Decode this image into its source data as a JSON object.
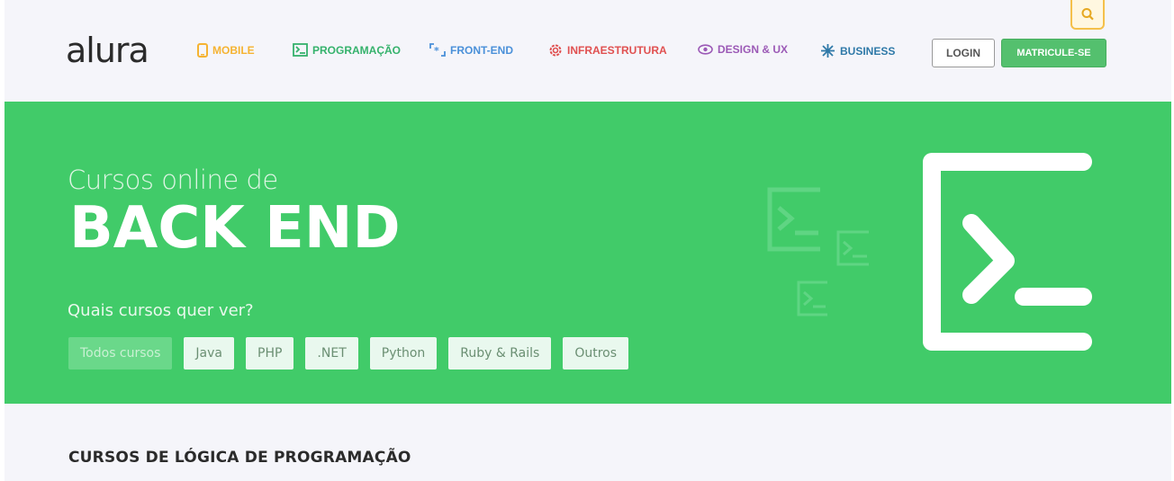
{
  "header": {
    "logo": "alura",
    "nav": [
      {
        "label": "MOBILE",
        "icon": "mobile-icon",
        "color": "#f5b332"
      },
      {
        "label": "PROGRAMAÇÃO",
        "icon": "terminal-icon",
        "color": "#35b26c"
      },
      {
        "label": "FRONT-END",
        "icon": "code-brackets-icon",
        "color": "#4a90d9"
      },
      {
        "label": "INFRAESTRUTURA",
        "icon": "gear-icon",
        "color": "#e05050"
      },
      {
        "label": "DESIGN & UX",
        "icon": "eye-icon",
        "color": "#9b59b6"
      },
      {
        "label": "BUSINESS",
        "icon": "network-icon",
        "color": "#2f79a8"
      }
    ],
    "login_label": "LOGIN",
    "signup_label": "MATRICULE-SE",
    "search_icon": "search-icon"
  },
  "hero": {
    "subtitle": "Cursos online de",
    "title": "BACK END",
    "question": "Quais cursos quer ver?",
    "filters": [
      "Todos cursos",
      "Java",
      "PHP",
      ".NET",
      "Python",
      "Ruby & Rails",
      "Outros"
    ],
    "active_filter": "Todos cursos",
    "bg_color": "#41cb69"
  },
  "section": {
    "title": "CURSOS DE LÓGICA DE PROGRAMAÇÃO"
  }
}
